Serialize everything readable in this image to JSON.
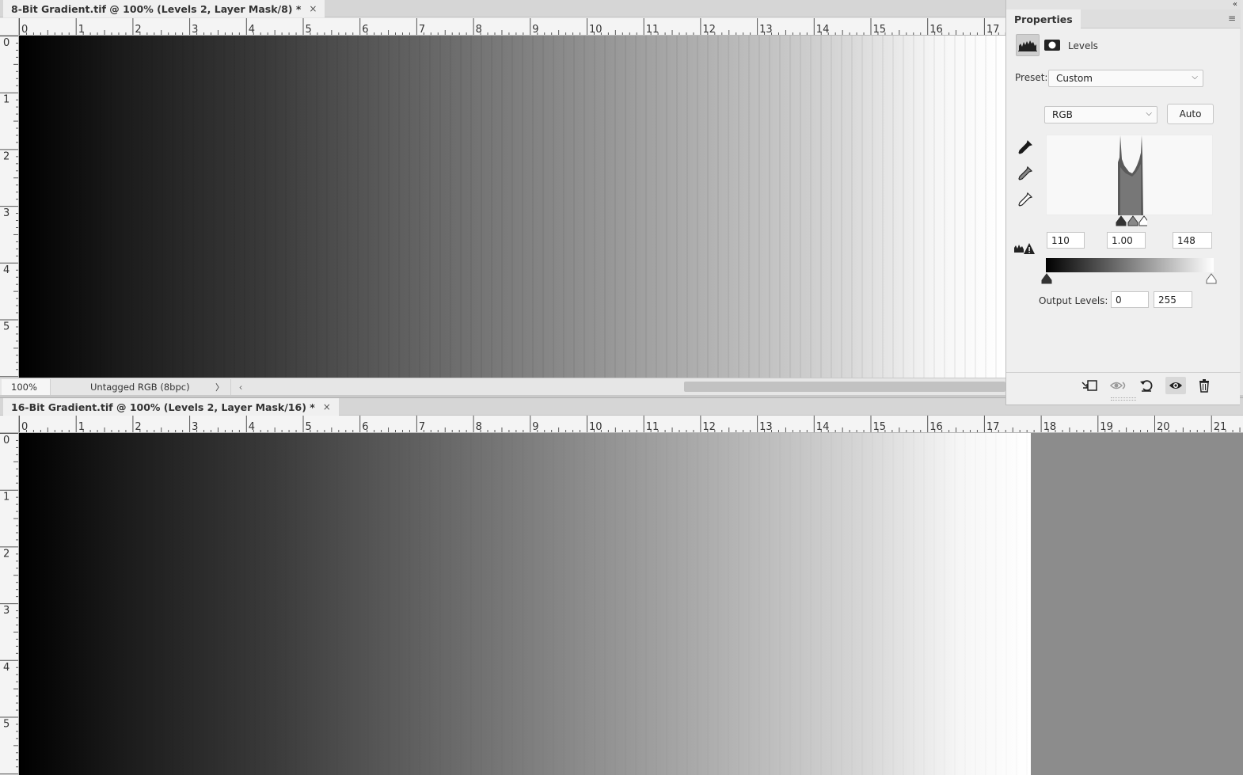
{
  "doc1": {
    "tab_title": "8-Bit Gradient.tif @ 100% (Levels 2, Layer Mask/8) *",
    "close_glyph": "×",
    "ruler_h": [
      "0",
      "1",
      "2",
      "3",
      "4",
      "5",
      "6",
      "7",
      "8",
      "9",
      "10",
      "11",
      "12",
      "13",
      "14",
      "15",
      "16",
      "17"
    ],
    "ruler_v": [
      "0",
      "1",
      "2",
      "3",
      "4",
      "5"
    ],
    "zoom": "100%",
    "doc_info": "Untagged RGB (8bpc)",
    "doc_info_arrow": "〉",
    "scroll_left_glyph": "‹"
  },
  "doc2": {
    "tab_title": "16-Bit Gradient.tif @ 100% (Levels 2, Layer Mask/16) *",
    "close_glyph": "×",
    "ruler_h": [
      "0",
      "1",
      "2",
      "3",
      "4",
      "5",
      "6",
      "7",
      "8",
      "9",
      "10",
      "11",
      "12",
      "13",
      "14",
      "15",
      "16",
      "17",
      "18",
      "19",
      "20",
      "21"
    ],
    "ruler_v": [
      "0",
      "1",
      "2",
      "3",
      "4",
      "5"
    ]
  },
  "properties": {
    "title": "Properties",
    "collapse_glyph": "«",
    "menu_glyph": "≡",
    "adjustment_name": "Levels",
    "preset_label": "Preset:",
    "preset_value": "Custom",
    "channel_value": "RGB",
    "auto_label": "Auto",
    "input_black": "110",
    "input_gamma": "1.00",
    "input_white": "148",
    "output_label": "Output Levels:",
    "output_black": "0",
    "output_white": "255",
    "chevron_glyph": "⌵",
    "icons": {
      "levels_tab": "histogram-icon",
      "mask_tab": "mask-icon",
      "eyedroppers": [
        "black-eyedropper-icon",
        "gray-eyedropper-icon",
        "white-eyedropper-icon"
      ],
      "clipping_warning": "clipping-warning-icon",
      "footer": [
        "clip-to-layer-icon",
        "view-previous-state-icon",
        "reset-icon",
        "visibility-eye-icon",
        "trash-icon"
      ]
    }
  },
  "colors": {
    "canvas_dark": "#000000",
    "canvas_light": "#ffffff",
    "pasteboard": "#8c8c8c",
    "panel_bg": "#efefef"
  }
}
